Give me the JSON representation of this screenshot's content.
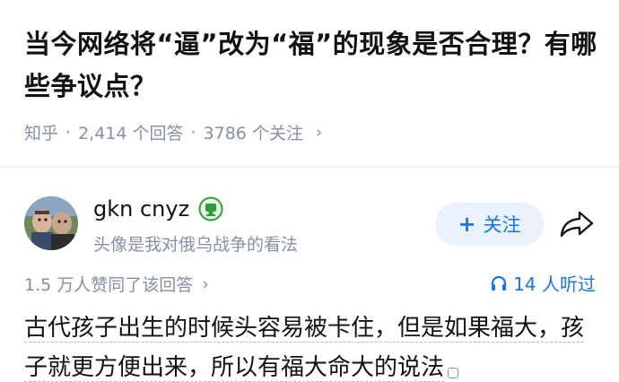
{
  "question": {
    "title": "当今网络将“逼”改为“福”的现象是否合理？有哪些争议点？",
    "source": "知乎",
    "answers": "2,414 个回答",
    "followers": "3786 个关注"
  },
  "author": {
    "name": "gkn cnyz",
    "bio": "头像是我对俄乌战争的看法"
  },
  "actions": {
    "follow_label": "关注",
    "plus_glyph": "+"
  },
  "stats": {
    "likes": "1.5 万人赞同了该回答",
    "listen": "14 人听过"
  },
  "answer": {
    "text": "古代孩子出生的时候头容易被卡住，但是如果福大，孩子就更方便出来，所以有福大命大的说法"
  },
  "colors": {
    "accent": "#1772f6",
    "meta": "#8590a6",
    "follow_bg": "#eaf2ff"
  }
}
